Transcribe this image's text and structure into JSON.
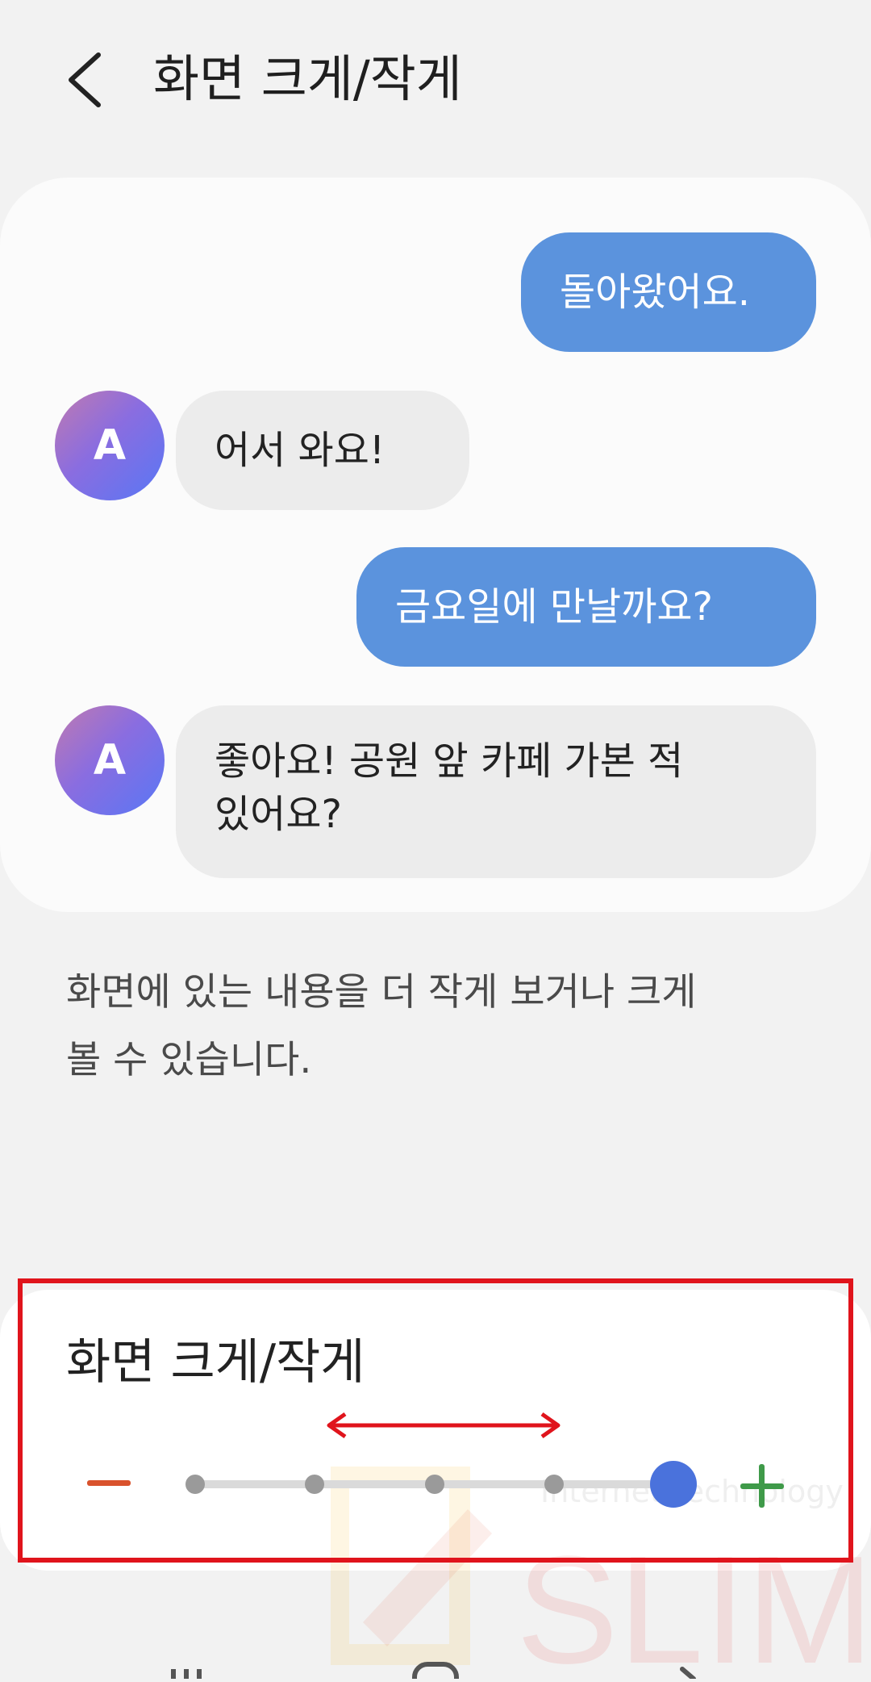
{
  "header": {
    "title": "화면 크게/작게",
    "back_icon": "back-chevron-icon"
  },
  "chat": {
    "messages": [
      {
        "side": "sent",
        "text": "돌아왔어요."
      },
      {
        "side": "received",
        "avatar_initial": "A",
        "text": "어서 와요!"
      },
      {
        "side": "sent",
        "text": "금요일에 만날까요?"
      },
      {
        "side": "received",
        "avatar_initial": "A",
        "lines": [
          "좋아요! 공원 앞 카페 가본 적",
          "있어요?"
        ]
      }
    ]
  },
  "description": {
    "lines": [
      "화면에 있는 내용을 더 작게 보거나 크게",
      "볼 수 있습니다."
    ]
  },
  "zoom_panel": {
    "title": "화면 크게/작게",
    "minus_icon": "minus-icon",
    "plus_icon": "plus-icon",
    "steps": 5,
    "selected_step": 5
  },
  "watermark": {
    "text": "Internet Technology",
    "logo_text": "SLIM"
  },
  "colors": {
    "sent_bubble": "#5b93dd",
    "received_bubble": "#ececec",
    "slider_thumb": "#4a72dc",
    "minus": "#d9522c",
    "plus": "#3f9a49",
    "highlight": "#e0141c"
  }
}
